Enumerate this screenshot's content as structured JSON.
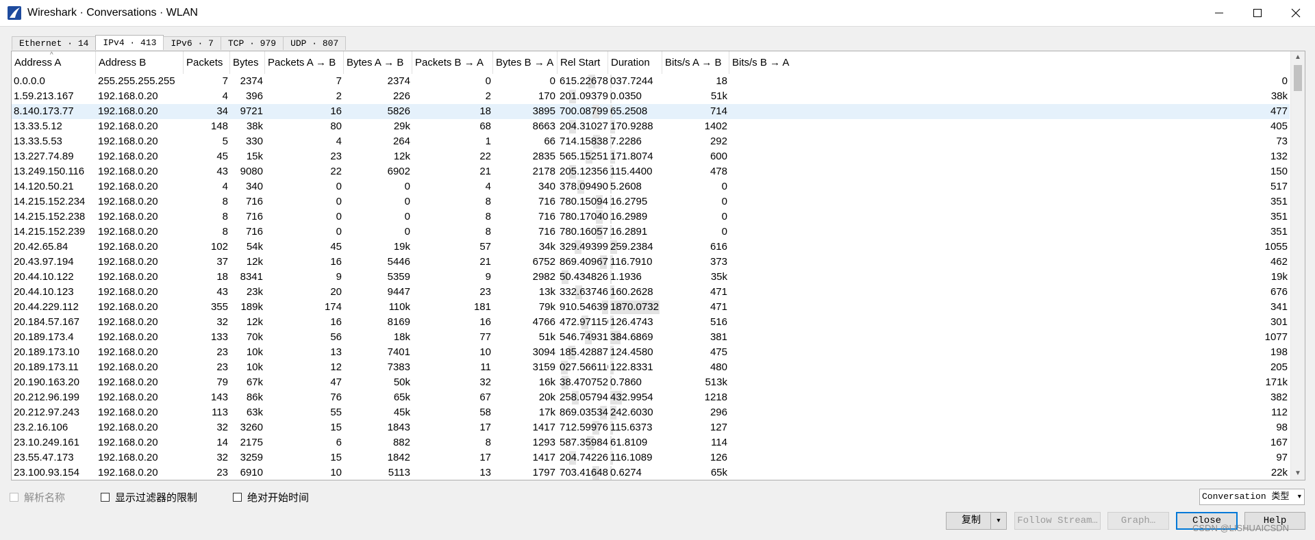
{
  "window": {
    "title": "Wireshark · Conversations · WLAN",
    "controls": [
      "minimize-icon",
      "maximize-icon",
      "close-icon"
    ]
  },
  "tabs": [
    {
      "label": "Ethernet · 14",
      "active": false
    },
    {
      "label": "IPv4 · 413",
      "active": true
    },
    {
      "label": "IPv6 · 7",
      "active": false
    },
    {
      "label": "TCP · 979",
      "active": false
    },
    {
      "label": "UDP · 807",
      "active": false
    }
  ],
  "table": {
    "columns": [
      "Address A",
      "Address B",
      "Packets",
      "Bytes",
      "Packets A → B",
      "Bytes A → B",
      "Packets B → A",
      "Bytes B → A",
      "Rel Start",
      "Duration",
      "Bits/s A → B",
      "Bits/s B → A"
    ],
    "selected_row": 2,
    "rows": [
      [
        "0.0.0.0",
        "255.255.255.255",
        "7",
        "2374",
        "7",
        "2374",
        "0",
        "0",
        "615.226781",
        "037.7244",
        "18",
        "0"
      ],
      [
        "1.59.213.167",
        "192.168.0.20",
        "4",
        "396",
        "2",
        "226",
        "2",
        "170",
        "201.093797",
        "0.0350",
        "51k",
        "38k"
      ],
      [
        "8.140.173.77",
        "192.168.0.20",
        "34",
        "9721",
        "16",
        "5826",
        "18",
        "3895",
        "700.087997",
        "65.2508",
        "714",
        "477"
      ],
      [
        "13.33.5.12",
        "192.168.0.20",
        "148",
        "38k",
        "80",
        "29k",
        "68",
        "8663",
        "204.310277",
        "170.9288",
        "1402",
        "405"
      ],
      [
        "13.33.5.53",
        "192.168.0.20",
        "5",
        "330",
        "4",
        "264",
        "1",
        "66",
        "714.158384",
        "7.2286",
        "292",
        "73"
      ],
      [
        "13.227.74.89",
        "192.168.0.20",
        "45",
        "15k",
        "23",
        "12k",
        "22",
        "2835",
        "565.152511",
        "171.8074",
        "600",
        "132"
      ],
      [
        "13.249.150.116",
        "192.168.0.20",
        "43",
        "9080",
        "22",
        "6902",
        "21",
        "2178",
        "205.123569",
        "115.4400",
        "478",
        "150"
      ],
      [
        "14.120.50.21",
        "192.168.0.20",
        "4",
        "340",
        "0",
        "0",
        "4",
        "340",
        "378.094909",
        "5.2608",
        "0",
        "517"
      ],
      [
        "14.215.152.234",
        "192.168.0.20",
        "8",
        "716",
        "0",
        "0",
        "8",
        "716",
        "780.150946",
        "16.2795",
        "0",
        "351"
      ],
      [
        "14.215.152.238",
        "192.168.0.20",
        "8",
        "716",
        "0",
        "0",
        "8",
        "716",
        "780.170402",
        "16.2989",
        "0",
        "351"
      ],
      [
        "14.215.152.239",
        "192.168.0.20",
        "8",
        "716",
        "0",
        "0",
        "8",
        "716",
        "780.160571",
        "16.2891",
        "0",
        "351"
      ],
      [
        "20.42.65.84",
        "192.168.0.20",
        "102",
        "54k",
        "45",
        "19k",
        "57",
        "34k",
        "329.493997",
        "259.2384",
        "616",
        "1055"
      ],
      [
        "20.43.97.194",
        "192.168.0.20",
        "37",
        "12k",
        "16",
        "5446",
        "21",
        "6752",
        "869.409671",
        "116.7910",
        "373",
        "462"
      ],
      [
        "20.44.10.122",
        "192.168.0.20",
        "18",
        "8341",
        "9",
        "5359",
        "9",
        "2982",
        "50.434826",
        "1.1936",
        "35k",
        "19k"
      ],
      [
        "20.44.10.123",
        "192.168.0.20",
        "43",
        "23k",
        "20",
        "9447",
        "23",
        "13k",
        "332.637469",
        "160.2628",
        "471",
        "676"
      ],
      [
        "20.44.229.112",
        "192.168.0.20",
        "355",
        "189k",
        "174",
        "110k",
        "181",
        "79k",
        "910.546391",
        "1870.0732",
        "471",
        "341"
      ],
      [
        "20.184.57.167",
        "192.168.0.20",
        "32",
        "12k",
        "16",
        "8169",
        "16",
        "4766",
        "472.971150",
        "126.4743",
        "516",
        "301"
      ],
      [
        "20.189.173.4",
        "192.168.0.20",
        "133",
        "70k",
        "56",
        "18k",
        "77",
        "51k",
        "546.749312",
        "384.6869",
        "381",
        "1077"
      ],
      [
        "20.189.173.10",
        "192.168.0.20",
        "23",
        "10k",
        "13",
        "7401",
        "10",
        "3094",
        "185.428874",
        "124.4580",
        "475",
        "198"
      ],
      [
        "20.189.173.11",
        "192.168.0.20",
        "23",
        "10k",
        "12",
        "7383",
        "11",
        "3159",
        "027.566110",
        "122.8331",
        "480",
        "205"
      ],
      [
        "20.190.163.20",
        "192.168.0.20",
        "79",
        "67k",
        "47",
        "50k",
        "32",
        "16k",
        "38.470752",
        "0.7860",
        "513k",
        "171k"
      ],
      [
        "20.212.96.199",
        "192.168.0.20",
        "143",
        "86k",
        "76",
        "65k",
        "67",
        "20k",
        "258.057941",
        "432.9954",
        "1218",
        "382"
      ],
      [
        "20.212.97.243",
        "192.168.0.20",
        "113",
        "63k",
        "55",
        "45k",
        "58",
        "17k",
        "869.035341",
        "242.6030",
        "296",
        "112"
      ],
      [
        "23.2.16.106",
        "192.168.0.20",
        "32",
        "3260",
        "15",
        "1843",
        "17",
        "1417",
        "712.599768",
        "115.6373",
        "127",
        "98"
      ],
      [
        "23.10.249.161",
        "192.168.0.20",
        "14",
        "2175",
        "6",
        "882",
        "8",
        "1293",
        "587.359845",
        "61.8109",
        "114",
        "167"
      ],
      [
        "23.55.47.173",
        "192.168.0.20",
        "32",
        "3259",
        "15",
        "1842",
        "17",
        "1417",
        "204.742269",
        "116.1089",
        "126",
        "97"
      ],
      [
        "23.100.93.154",
        "192.168.0.20",
        "23",
        "6910",
        "10",
        "5113",
        "13",
        "1797",
        "703.416484",
        "0.6274",
        "65k",
        "22k"
      ]
    ]
  },
  "options": {
    "name_resolution": {
      "label": "解析名称",
      "checked": false,
      "enabled": false
    },
    "limit_to_filter": {
      "label": "显示过滤器的限制",
      "checked": false,
      "enabled": true
    },
    "absolute_start": {
      "label": "绝对开始时间",
      "checked": false,
      "enabled": true
    }
  },
  "conversation_type": {
    "label": "Conversation 类型"
  },
  "buttons": {
    "copy": "复制",
    "follow_stream": "Follow Stream…",
    "graph": "Graph…",
    "close": "Close",
    "help": "Help"
  },
  "watermark": "CSDN @LISHUAICSDN"
}
